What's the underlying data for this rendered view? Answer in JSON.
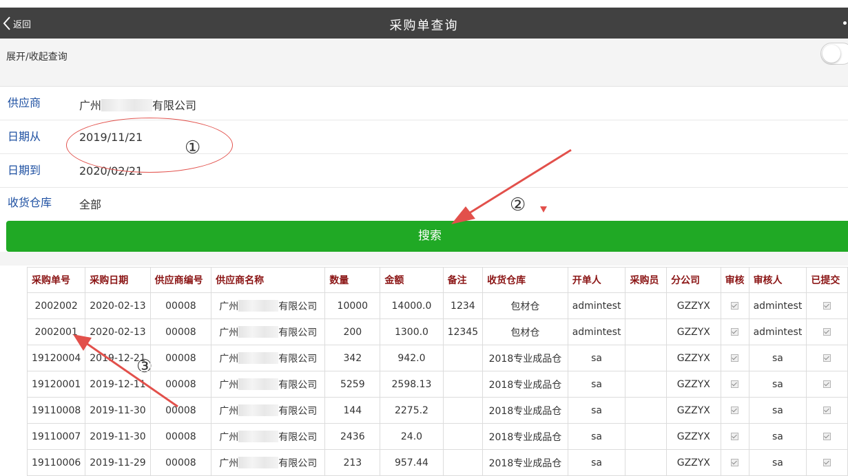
{
  "navbar": {
    "back_label": "返回",
    "title": "采购单查询"
  },
  "toggle": {
    "label": "展开/收起查询"
  },
  "form": {
    "supplier": {
      "label": "供应商",
      "value_prefix": "广州",
      "value_suffix": "有限公司"
    },
    "date_from": {
      "label": "日期从",
      "value": "2019/11/21"
    },
    "date_to": {
      "label": "日期到",
      "value": "2020/02/21"
    },
    "warehouse": {
      "label": "收货仓库",
      "value": "全部"
    }
  },
  "search": {
    "label": "搜索"
  },
  "annotations": {
    "one": "①",
    "two": "②",
    "three": "③"
  },
  "table": {
    "headers": [
      "采购单号",
      "采购日期",
      "供应商编号",
      "供应商名称",
      "数量",
      "金额",
      "备注",
      "收货仓库",
      "开单人",
      "采购员",
      "分公司",
      "审核",
      "审核人",
      "已提交"
    ],
    "supplier_prefix": "广州",
    "supplier_suffix": "有限公司",
    "rows": [
      {
        "no": "2002002",
        "date": "2020-02-13",
        "code": "00008",
        "qty": "10000",
        "amount": "14000.0",
        "note": "1234",
        "warehouse": "包材仓",
        "creator": "admintest",
        "buyer": "",
        "branch": "GZZYX",
        "reviewer": "admintest"
      },
      {
        "no": "2002001",
        "date": "2020-02-13",
        "code": "00008",
        "qty": "200",
        "amount": "1300.0",
        "note": "12345",
        "warehouse": "包材仓",
        "creator": "admintest",
        "buyer": "",
        "branch": "GZZYX",
        "reviewer": "admintest"
      },
      {
        "no": "19120004",
        "date": "2019-12-21",
        "code": "00008",
        "qty": "342",
        "amount": "942.0",
        "note": "",
        "warehouse": "2018专业成品仓",
        "creator": "sa",
        "buyer": "",
        "branch": "GZZYX",
        "reviewer": "sa"
      },
      {
        "no": "19120001",
        "date": "2019-12-11",
        "code": "00008",
        "qty": "5259",
        "amount": "2598.13",
        "note": "",
        "warehouse": "2018专业成品仓",
        "creator": "sa",
        "buyer": "",
        "branch": "GZZYX",
        "reviewer": "sa"
      },
      {
        "no": "19110008",
        "date": "2019-11-30",
        "code": "00008",
        "qty": "144",
        "amount": "2275.2",
        "note": "",
        "warehouse": "2018专业成品仓",
        "creator": "sa",
        "buyer": "",
        "branch": "GZZYX",
        "reviewer": "sa"
      },
      {
        "no": "19110007",
        "date": "2019-11-30",
        "code": "00008",
        "qty": "2436",
        "amount": "24.0",
        "note": "",
        "warehouse": "2018专业成品仓",
        "creator": "sa",
        "buyer": "",
        "branch": "GZZYX",
        "reviewer": "sa"
      },
      {
        "no": "19110006",
        "date": "2019-11-29",
        "code": "00008",
        "qty": "213",
        "amount": "957.44",
        "note": "",
        "warehouse": "2018专业成品仓",
        "creator": "sa",
        "buyer": "",
        "branch": "GZZYX",
        "reviewer": "sa"
      }
    ]
  },
  "colors": {
    "navbar": "#414141",
    "search_button": "#20a925",
    "label_blue": "#1e50a2",
    "header_red": "#8b1515",
    "link_blue": "#3a6fb5",
    "annotation_red": "#e2504b"
  }
}
